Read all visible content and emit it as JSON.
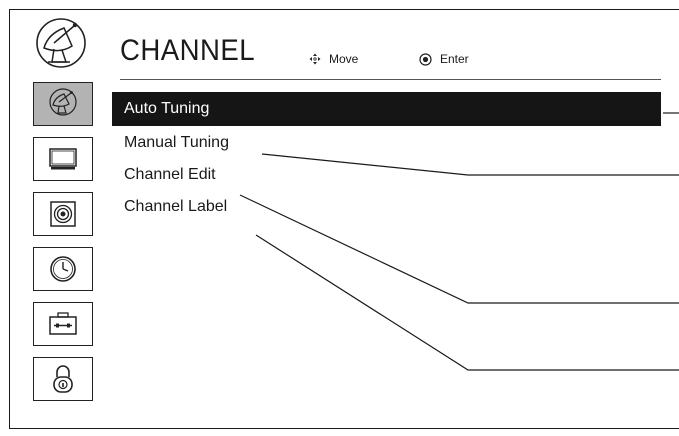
{
  "header": {
    "title": "CHANNEL",
    "move_hint": "Move",
    "enter_hint": "Enter"
  },
  "sidebar": {
    "items": [
      {
        "icon": "satellite-icon",
        "active": true
      },
      {
        "icon": "tv-icon",
        "active": false
      },
      {
        "icon": "speaker-icon",
        "active": false
      },
      {
        "icon": "clock-icon",
        "active": false
      },
      {
        "icon": "toolbox-icon",
        "active": false
      },
      {
        "icon": "lock-icon",
        "active": false
      }
    ]
  },
  "menu": {
    "items": [
      {
        "label": "Auto Tuning",
        "selected": true
      },
      {
        "label": "Manual Tuning",
        "selected": false
      },
      {
        "label": "Channel Edit",
        "selected": false
      },
      {
        "label": "Channel Label",
        "selected": false
      }
    ]
  },
  "colors": {
    "selected_bg": "#151515",
    "active_sidebar_bg": "#b3b3b3"
  }
}
